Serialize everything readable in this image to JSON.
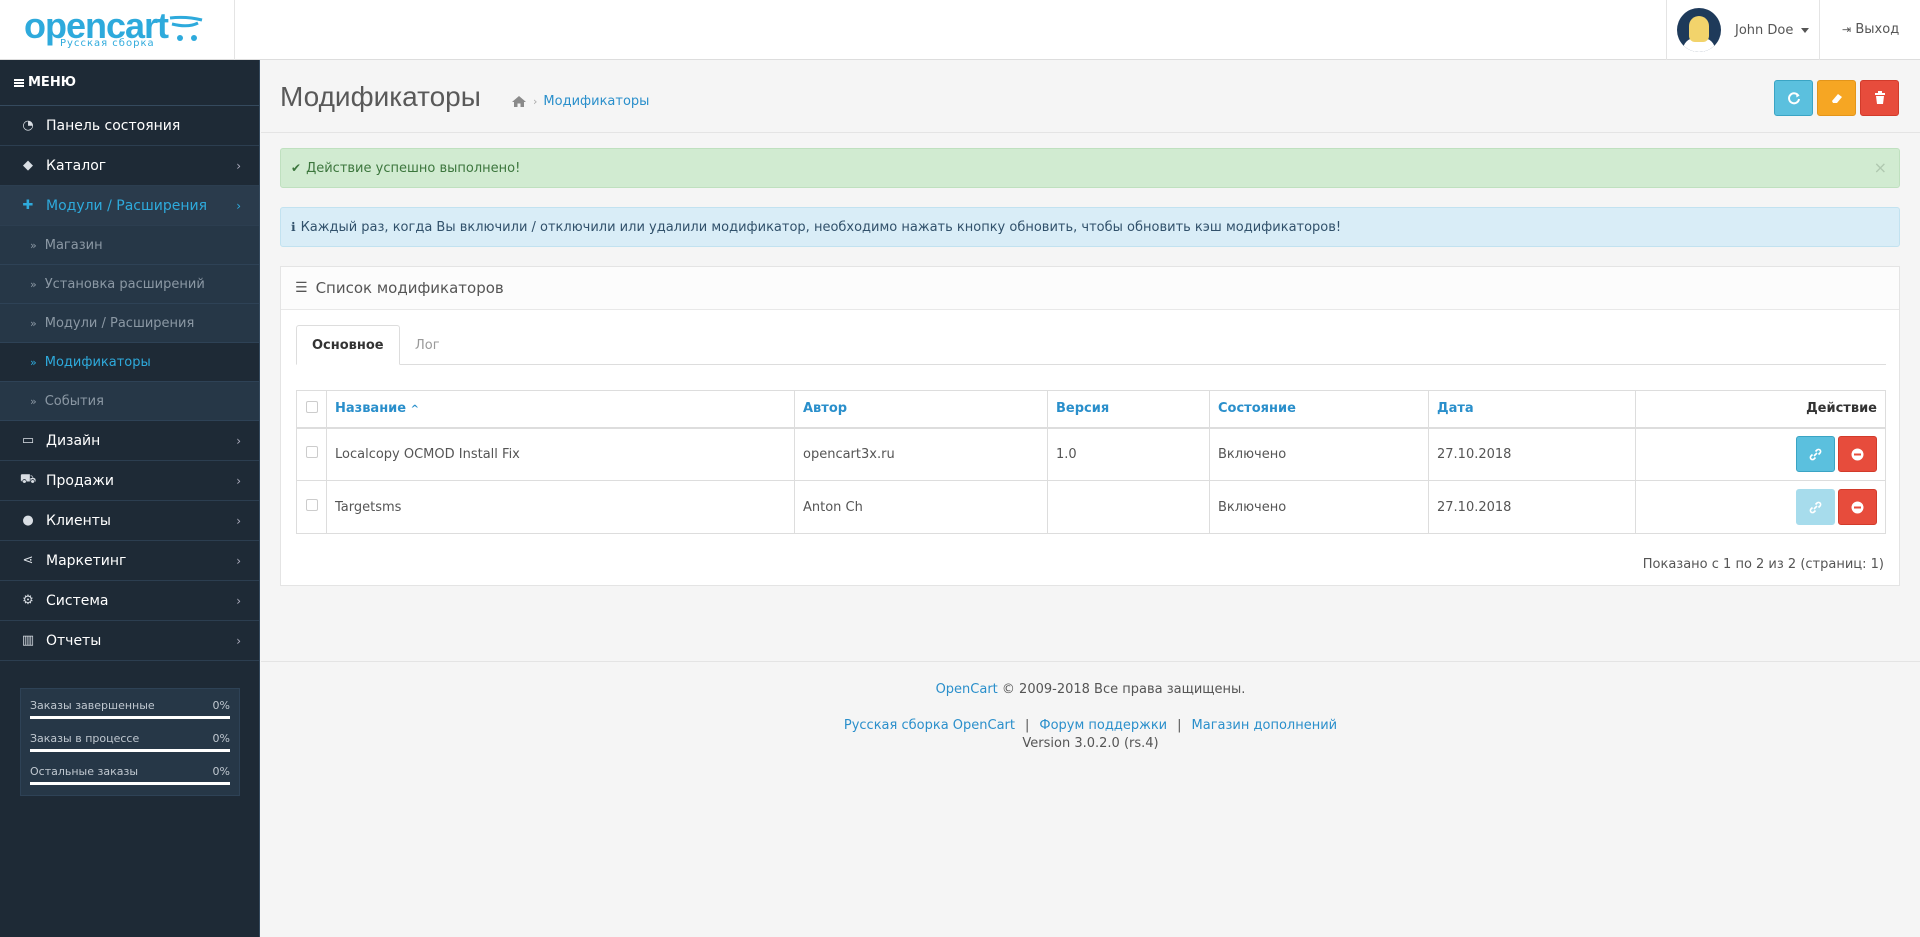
{
  "header": {
    "logo_text": "opencart",
    "logo_sub": "Русская сборка",
    "user_name": "John Doe",
    "logout_label": "Выход"
  },
  "sidebar": {
    "menu_label": "МЕНЮ",
    "items": [
      {
        "label": "Панель состояния",
        "icon": "dashboard-icon"
      },
      {
        "label": "Каталог",
        "icon": "tags-icon"
      },
      {
        "label": "Модули / Расширения",
        "icon": "puzzle-icon"
      },
      {
        "label": "Дизайн",
        "icon": "monitor-icon"
      },
      {
        "label": "Продажи",
        "icon": "cart-icon"
      },
      {
        "label": "Клиенты",
        "icon": "user-icon"
      },
      {
        "label": "Маркетинг",
        "icon": "share-icon"
      },
      {
        "label": "Система",
        "icon": "gear-icon"
      },
      {
        "label": "Отчеты",
        "icon": "bar-chart-icon"
      }
    ],
    "subitems": [
      {
        "label": "Магазин"
      },
      {
        "label": "Установка расширений"
      },
      {
        "label": "Модули / Расширения"
      },
      {
        "label": "Модификаторы"
      },
      {
        "label": "События"
      }
    ],
    "progress": [
      {
        "label": "Заказы завершенные",
        "pct_text": "0%",
        "value": 0
      },
      {
        "label": "Заказы в процессе",
        "pct_text": "0%",
        "value": 0
      },
      {
        "label": "Остальные заказы",
        "pct_text": "0%",
        "value": 0
      }
    ]
  },
  "page": {
    "title": "Модификаторы",
    "breadcrumb": "Модификаторы"
  },
  "alerts": {
    "success": "Действие успешно выполнено!",
    "close": "×",
    "info": "Каждый раз, когда Вы включили / отключили или удалили модификатор, необходимо нажать кнопку обновить, чтобы обновить кэш модификаторов!"
  },
  "panel": {
    "title": "Список модификаторов",
    "tabs": [
      "Основное",
      "Лог"
    ]
  },
  "table": {
    "headers": {
      "name": "Название",
      "author": "Автор",
      "version": "Версия",
      "status": "Состояние",
      "date": "Дата",
      "action": "Действие"
    },
    "rows": [
      {
        "name": "Localcopy OCMOD Install Fix",
        "author": "opencart3x.ru",
        "version": "1.0",
        "status": "Включено",
        "date": "27.10.2018"
      },
      {
        "name": "Targetsms",
        "author": "Anton Ch",
        "version": "",
        "status": "Включено",
        "date": "27.10.2018"
      }
    ],
    "pager": "Показано с 1 по 2 из 2 (страниц: 1)"
  },
  "footer": {
    "brand": "OpenCart",
    "copyright": "© 2009-2018 Все права защищены.",
    "links": [
      "Русская сборка OpenCart",
      "Форум поддержки",
      "Магазин дополнений"
    ],
    "version": "Version 3.0.2.0 (rs.4)"
  },
  "colors": {
    "accent": "#2eaadc",
    "sidebar_bg": "#1e2a36",
    "success_bg": "#d1ebd1",
    "info_bg": "#d9edf7",
    "btn_info": "#5bc0de",
    "btn_warning": "#f6a623",
    "btn_danger": "#e74c3c"
  }
}
